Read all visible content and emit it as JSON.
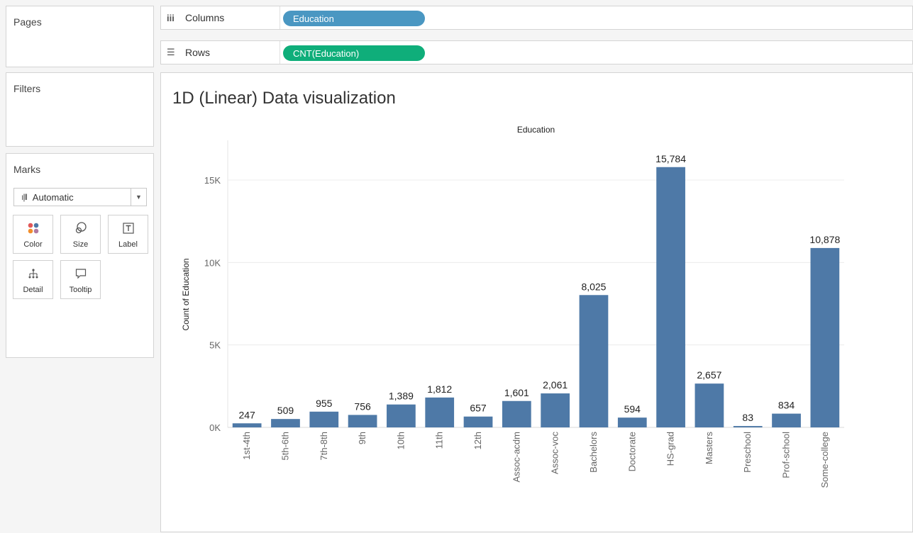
{
  "pages": {
    "title": "Pages"
  },
  "filters": {
    "title": "Filters"
  },
  "marks": {
    "title": "Marks",
    "type_selected": "Automatic",
    "buttons": [
      {
        "label": "Color",
        "icon": "color-icon"
      },
      {
        "label": "Size",
        "icon": "size-icon"
      },
      {
        "label": "Label",
        "icon": "label-icon"
      },
      {
        "label": "Detail",
        "icon": "detail-icon"
      },
      {
        "label": "Tooltip",
        "icon": "tooltip-icon"
      }
    ]
  },
  "shelves": {
    "columns": {
      "label": "Columns",
      "pill": "Education"
    },
    "rows": {
      "label": "Rows",
      "pill": "CNT(Education)"
    }
  },
  "colors": {
    "bar": "#4e79a7",
    "dimension_pill": "#4a97c2",
    "measure_pill": "#0fae7a"
  },
  "viz": {
    "title": "1D (Linear) Data visualization"
  },
  "chart_data": {
    "type": "bar",
    "column_header": "Education",
    "ylabel": "Count of Education",
    "categories": [
      "1st-4th",
      "5th-6th",
      "7th-8th",
      "9th",
      "10th",
      "11th",
      "12th",
      "Assoc-acdm",
      "Assoc-voc",
      "Bachelors",
      "Doctorate",
      "HS-grad",
      "Masters",
      "Preschool",
      "Prof-school",
      "Some-college"
    ],
    "values": [
      247,
      509,
      955,
      756,
      1389,
      1812,
      657,
      1601,
      2061,
      8025,
      594,
      15784,
      2657,
      83,
      834,
      10878
    ],
    "value_labels": [
      "247",
      "509",
      "955",
      "756",
      "1,389",
      "1,812",
      "657",
      "1,601",
      "2,061",
      "8,025",
      "594",
      "15,784",
      "2,657",
      "83",
      "834",
      "10,878"
    ],
    "yticks": [
      0,
      5000,
      10000,
      15000
    ],
    "ytick_labels": [
      "0K",
      "5K",
      "10K",
      "15K"
    ],
    "ylim": [
      0,
      17000
    ],
    "grid": true
  }
}
